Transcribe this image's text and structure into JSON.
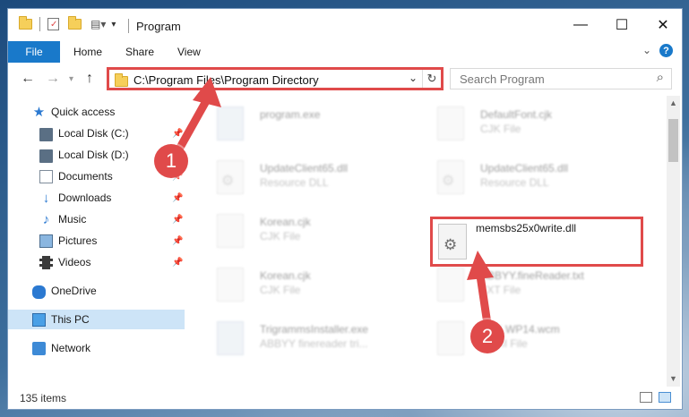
{
  "window": {
    "title": "Program",
    "controls": {
      "minimize": "—",
      "maximize": "☐",
      "close": "✕"
    }
  },
  "ribbon": {
    "tabs": [
      {
        "label": "File"
      },
      {
        "label": "Home"
      },
      {
        "label": "Share"
      },
      {
        "label": "View"
      }
    ],
    "help": "?"
  },
  "navigation": {
    "address_path": "C:\\Program Files\\Program Directory",
    "search_placeholder": "Search Program"
  },
  "sidebar": {
    "items": [
      {
        "label": "Quick access",
        "icon": "star-icon"
      },
      {
        "label": "Local Disk (C:)",
        "icon": "drive-icon",
        "pinned": true
      },
      {
        "label": "Local Disk (D:)",
        "icon": "drive-icon",
        "pinned": true
      },
      {
        "label": "Documents",
        "icon": "documents-icon",
        "pinned": true
      },
      {
        "label": "Downloads",
        "icon": "downloads-icon",
        "pinned": true
      },
      {
        "label": "Music",
        "icon": "music-icon",
        "pinned": true
      },
      {
        "label": "Pictures",
        "icon": "pictures-icon",
        "pinned": true
      },
      {
        "label": "Videos",
        "icon": "videos-icon",
        "pinned": true
      },
      {
        "label": "OneDrive",
        "icon": "cloud-icon"
      },
      {
        "label": "This PC",
        "icon": "computer-icon",
        "selected": true
      },
      {
        "label": "Network",
        "icon": "network-icon"
      }
    ]
  },
  "files": [
    {
      "name": "program.exe",
      "type": "",
      "icon": "exe-icon"
    },
    {
      "name": "DefaultFont.cjk",
      "type": "CJK File",
      "icon": "file-icon"
    },
    {
      "name": "UpdateClient65.dll",
      "type": "Resource DLL",
      "icon": "dll-icon"
    },
    {
      "name": "UpdateClient65.dll",
      "type": "Resource DLL",
      "icon": "dll-icon"
    },
    {
      "name": "Korean.cjk",
      "type": "CJK File",
      "icon": "file-icon"
    },
    {
      "name": "memsbs25x0write.dll",
      "type": "",
      "icon": "dll-icon",
      "highlighted": true
    },
    {
      "name": "Korean.cjk",
      "type": "CJK File",
      "icon": "file-icon"
    },
    {
      "name": "ABBYY.fineReader.txt",
      "type": "TXT File",
      "icon": "file-icon"
    },
    {
      "name": "TrigrammsInstaller.exe",
      "type": "ABBYY finereader tri...",
      "icon": "exe-icon"
    },
    {
      "name": "SDK.WP14.wcm",
      "type": "WCM File",
      "icon": "file-icon"
    }
  ],
  "status": {
    "item_count": "135 items"
  },
  "annotations": {
    "step1": "1",
    "step2": "2",
    "color": "#e04a4a"
  }
}
